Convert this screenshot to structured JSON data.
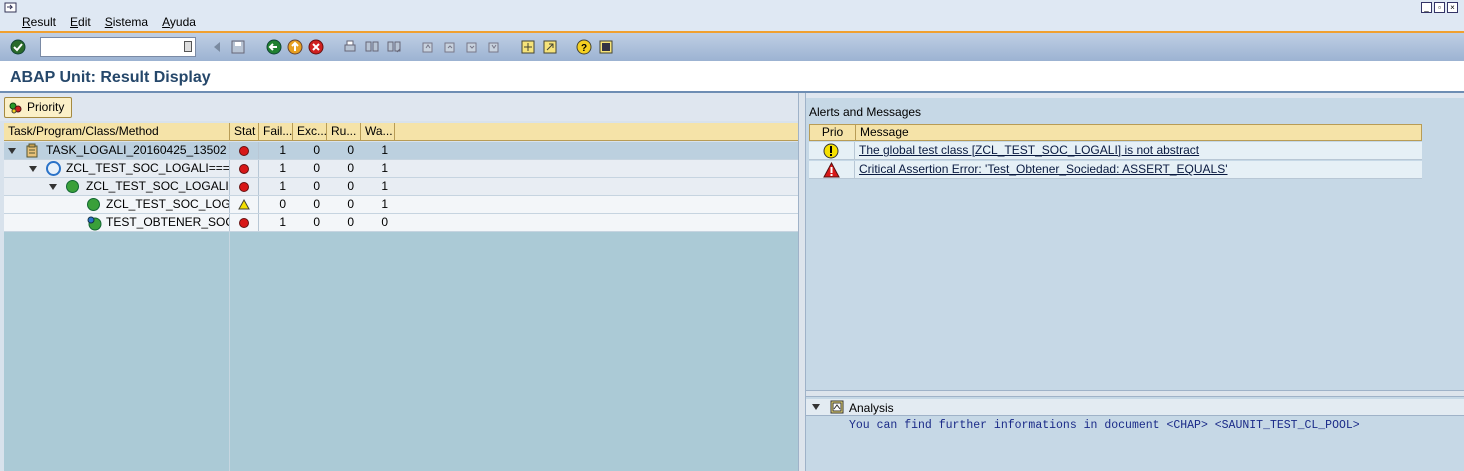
{
  "menubar": {
    "items": [
      "Result",
      "Edit",
      "Sistema",
      "Ayuda"
    ]
  },
  "toolbar": {
    "command_value": ""
  },
  "page": {
    "title": "ABAP Unit: Result Display"
  },
  "left_panel": {
    "priority_button": "Priority",
    "columns": [
      "Task/Program/Class/Method",
      "Stat",
      "Fail...",
      "Exc...",
      "Ru...",
      "Wa..."
    ],
    "rows": [
      {
        "name": "TASK_LOGALI_20160425_13502",
        "fail": "1",
        "exc": "0",
        "ru": "0",
        "wa": "1",
        "status": "error",
        "icon": "task-icon",
        "level": 0
      },
      {
        "name": "ZCL_TEST_SOC_LOGALI===",
        "fail": "1",
        "exc": "0",
        "ru": "0",
        "wa": "1",
        "status": "error",
        "icon": "program-icon",
        "level": 1
      },
      {
        "name": "ZCL_TEST_SOC_LOGALI",
        "fail": "1",
        "exc": "0",
        "ru": "0",
        "wa": "1",
        "status": "error",
        "icon": "class-icon",
        "level": 2
      },
      {
        "name": "ZCL_TEST_SOC_LOGA",
        "fail": "0",
        "exc": "0",
        "ru": "0",
        "wa": "1",
        "status": "warning",
        "icon": "class-icon",
        "level": 3
      },
      {
        "name": "TEST_OBTENER_SOCI",
        "fail": "1",
        "exc": "0",
        "ru": "0",
        "wa": "0",
        "status": "error",
        "icon": "method-icon",
        "level": 3
      }
    ]
  },
  "alerts": {
    "caption": "Alerts and Messages",
    "columns": [
      "Prio",
      "Message"
    ],
    "rows": [
      {
        "prio": "warning",
        "message": "The global test class [ZCL_TEST_SOC_LOGALI] is not abstract"
      },
      {
        "prio": "critical",
        "message": "Critical Assertion Error: 'Test_Obtener_Sociedad: ASSERT_EQUALS'"
      }
    ]
  },
  "analysis": {
    "label": "Analysis",
    "info": "You can find further informations in document <CHAP> <SAUNIT_TEST_CL_POOL>"
  },
  "colors": {
    "accent": "#f0a030",
    "title": "#25476a",
    "error": "#d81818",
    "warning": "#f5e000"
  }
}
